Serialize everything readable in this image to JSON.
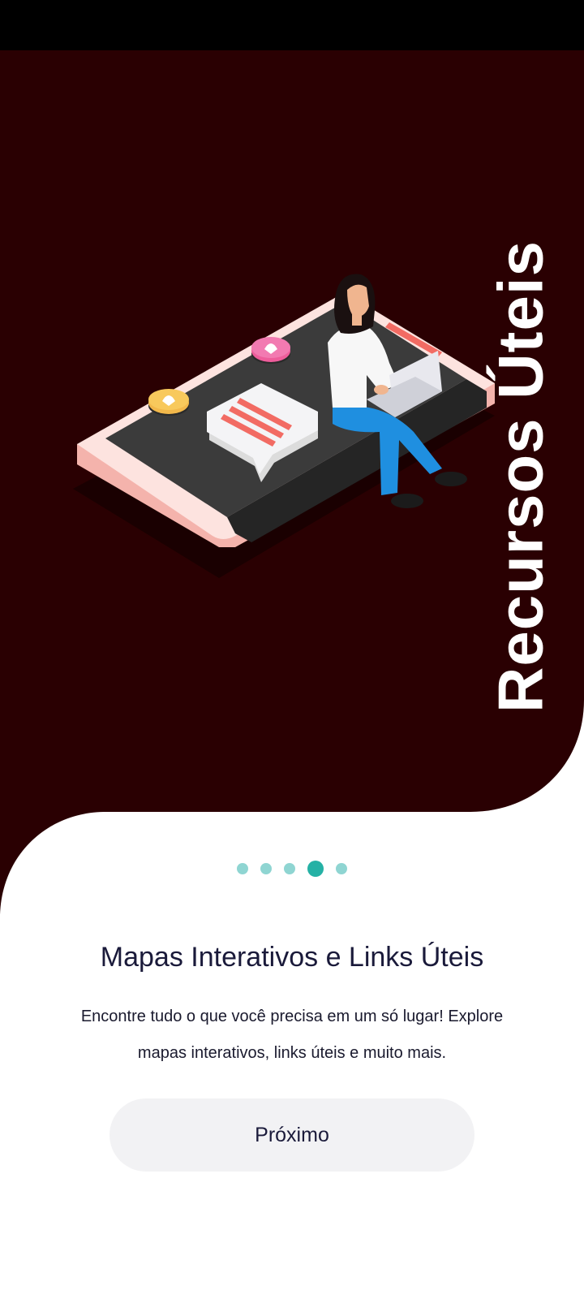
{
  "onboarding": {
    "vertical_title": "Recursos Úteis",
    "headline": "Mapas Interativos e Links Úteis",
    "description": "Encontre tudo o que você precisa em um só lugar! Explore mapas interativos, links úteis e muito mais.",
    "next_button_label": "Próximo",
    "pagination": {
      "total": 5,
      "active_index": 3
    }
  },
  "colors": {
    "hero_background": "#2a0002",
    "accent": "#25b1a5",
    "dot_inactive": "#8fd5d2",
    "button_background": "#f2f2f4"
  },
  "icons": [
    "phone-illustration",
    "woman-with-laptop-illustration",
    "location-pin-icon",
    "chat-bubble-icon"
  ]
}
